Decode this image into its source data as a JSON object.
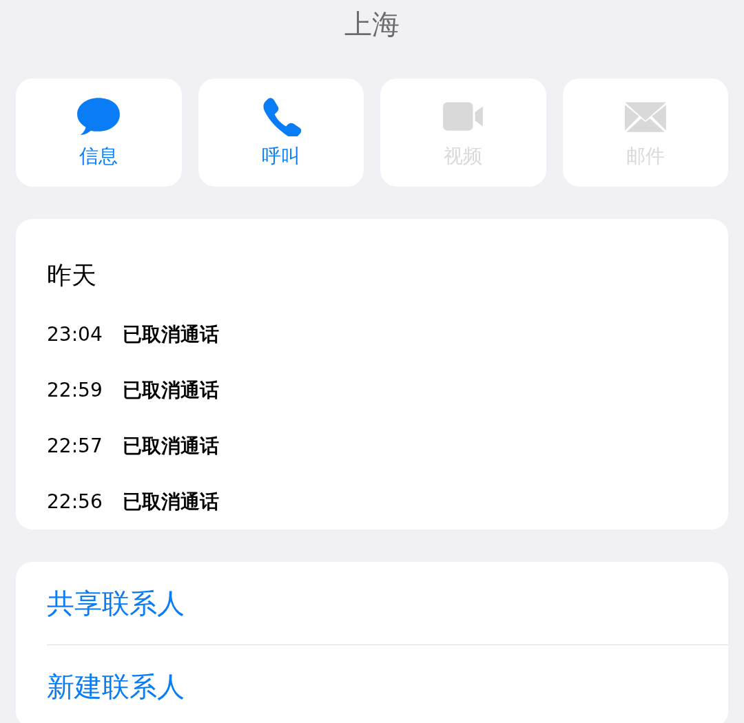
{
  "title": "上海",
  "actions": [
    {
      "kind": "message",
      "label": "信息",
      "disabled": false
    },
    {
      "kind": "phone",
      "label": "呼叫",
      "disabled": false
    },
    {
      "kind": "video",
      "label": "视频",
      "disabled": true
    },
    {
      "kind": "mail",
      "label": "邮件",
      "disabled": true
    }
  ],
  "call_history": {
    "date": "昨天",
    "calls": [
      {
        "time": "23:04",
        "status": "已取消通话"
      },
      {
        "time": "22:59",
        "status": "已取消通话"
      },
      {
        "time": "22:57",
        "status": "已取消通话"
      },
      {
        "time": "22:56",
        "status": "已取消通话"
      }
    ]
  },
  "links": [
    "共享联系人",
    "新建联系人"
  ]
}
